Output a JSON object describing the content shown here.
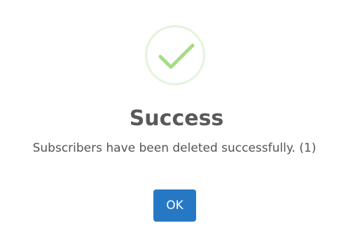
{
  "dialog": {
    "icon": "success-checkmark-icon",
    "title": "Success",
    "message": "Subscribers have been deleted successfully. (1)",
    "ok_label": "OK"
  },
  "colors": {
    "icon_ring": "#e3f4d9",
    "icon_check": "#a5dc86",
    "title": "#595959",
    "message": "#545454",
    "button_bg": "#2778c4",
    "button_text": "#ffffff"
  }
}
